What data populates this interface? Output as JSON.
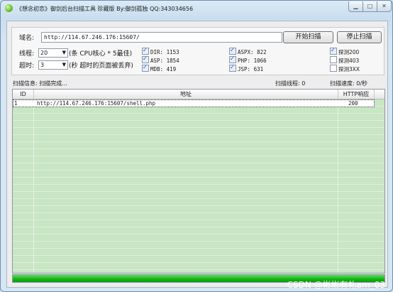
{
  "window": {
    "title": "《想念初恋》御剑后台扫描工具 珍藏版 By:御剑孤独 QQ:343034656",
    "controls": {
      "minimize": "▁",
      "maximize": "□",
      "close": "✕"
    }
  },
  "form": {
    "domain_label": "域名:",
    "domain_value": "http://114.67.246.176:15607/",
    "threads_label": "线程:",
    "threads_value": "20",
    "threads_hint": "(条 CPU核心 * 5最佳)",
    "timeout_label": "超时:",
    "timeout_value": "3",
    "timeout_hint": "(秒 超时的页面被丢弃)",
    "start_button": "开始扫描",
    "stop_button": "停止扫描"
  },
  "dicts": [
    {
      "label": "DIR: 1153",
      "checked": true
    },
    {
      "label": "ASP: 1854",
      "checked": true
    },
    {
      "label": "MDB: 419",
      "checked": true
    },
    {
      "label": "ASPX: 822",
      "checked": true
    },
    {
      "label": "PHP: 1066",
      "checked": true
    },
    {
      "label": "JSP: 631",
      "checked": true
    }
  ],
  "probes": [
    {
      "label": "探测200",
      "checked": true
    },
    {
      "label": "探测403",
      "checked": false
    },
    {
      "label": "探测3XX",
      "checked": false
    }
  ],
  "status": {
    "info": "扫描信息: 扫描完成...",
    "threads": "扫描线程: 0",
    "speed": "扫描速度: 0/秒"
  },
  "table": {
    "columns": [
      "ID",
      "地址",
      "HTTP响应"
    ],
    "rows": [
      {
        "id": "1",
        "url": "http://114.67.246.176:15607/shell.php",
        "code": "200"
      }
    ]
  },
  "progress": {
    "percent": 100,
    "color": "#14b814"
  },
  "watermark": "CSDN @彬彬有礼am_03"
}
